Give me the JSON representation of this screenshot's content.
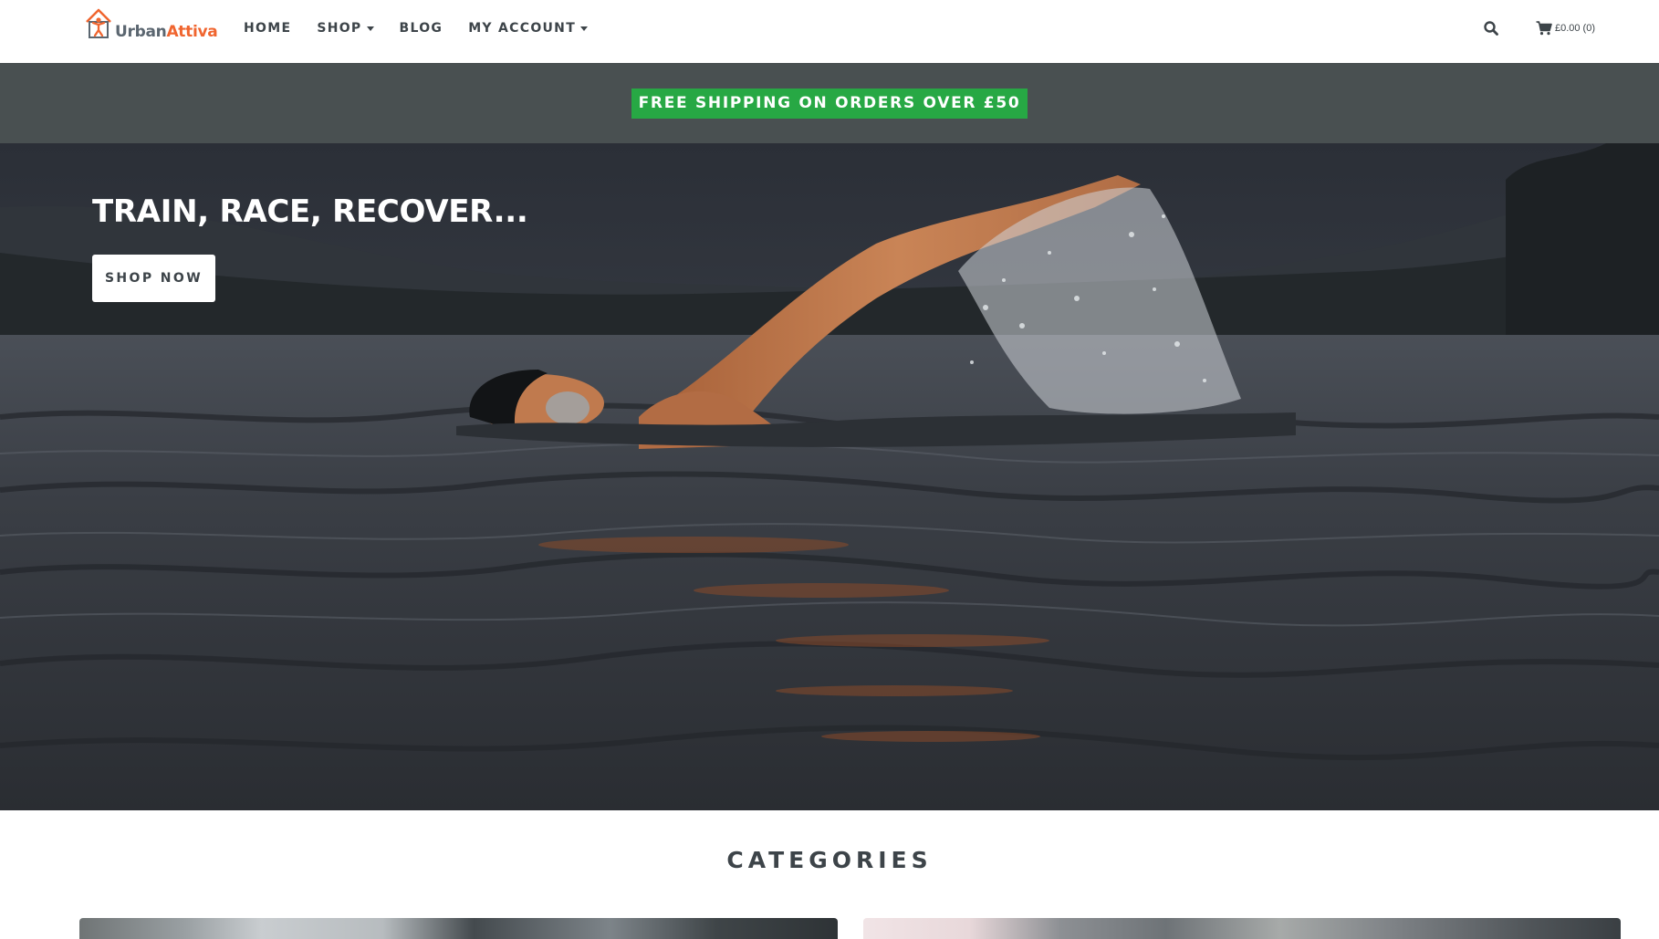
{
  "brand": {
    "part1": "Urban",
    "part2": "Attiva",
    "accent": "#f0652f",
    "dark": "#5b6670"
  },
  "nav": {
    "items": [
      {
        "label": "HOME",
        "dropdown": false
      },
      {
        "label": "SHOP",
        "dropdown": true
      },
      {
        "label": "BLOG",
        "dropdown": false
      },
      {
        "label": "MY ACCOUNT",
        "dropdown": true
      }
    ],
    "search_icon": "search-icon",
    "cart_icon": "cart-icon",
    "cart_label": "£0.00 (0)"
  },
  "promo": {
    "text": "FREE SHIPPING ON ORDERS OVER £50",
    "color": "#27a844",
    "bar_color": "#495051"
  },
  "hero": {
    "title": "TRAIN, RACE, RECOVER...",
    "button_label": "SHOP NOW"
  },
  "categories": {
    "title": "CATEGORIES"
  }
}
